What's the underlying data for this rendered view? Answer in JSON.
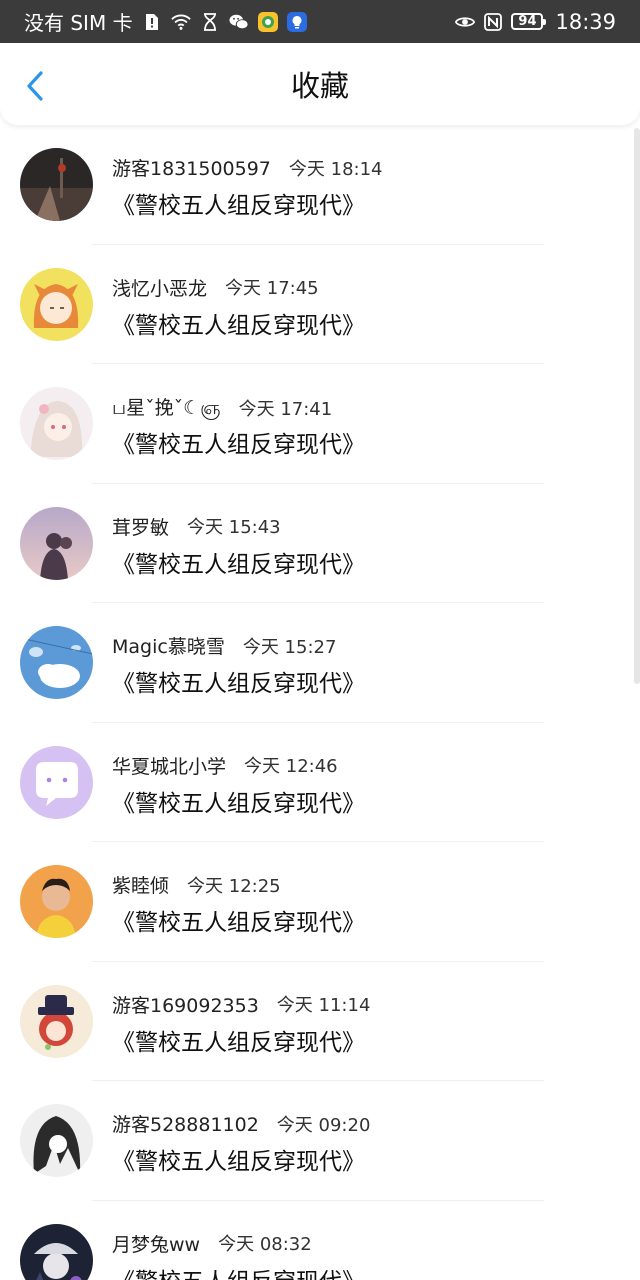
{
  "status_bar": {
    "carrier": "没有 SIM 卡",
    "battery": "94",
    "time": "18:39"
  },
  "header": {
    "title": "收藏"
  },
  "items": [
    {
      "user": "游客1831500597",
      "time": "今天 18:14",
      "book": "《警校五人组反穿现代》"
    },
    {
      "user": "浅忆小恶龙",
      "time": "今天 17:45",
      "book": "《警校五人组反穿现代》"
    },
    {
      "user": "ப星ˇ挽ˇ☾ஞ",
      "time": "今天 17:41",
      "book": "《警校五人组反穿现代》"
    },
    {
      "user": "茸罗敏",
      "time": "今天 15:43",
      "book": "《警校五人组反穿现代》"
    },
    {
      "user": "Magic慕晓雪",
      "time": "今天 15:27",
      "book": "《警校五人组反穿现代》"
    },
    {
      "user": "华夏城北小学",
      "time": "今天 12:46",
      "book": "《警校五人组反穿现代》"
    },
    {
      "user": "紫睦倾",
      "time": "今天 12:25",
      "book": "《警校五人组反穿现代》"
    },
    {
      "user": "游客169092353",
      "time": "今天 11:14",
      "book": "《警校五人组反穿现代》"
    },
    {
      "user": "游客528881102",
      "time": "今天 09:20",
      "book": "《警校五人组反穿现代》"
    },
    {
      "user": "月梦兔ww",
      "time": "今天 08:32",
      "book": "《警校五人组反穿现代》"
    }
  ]
}
